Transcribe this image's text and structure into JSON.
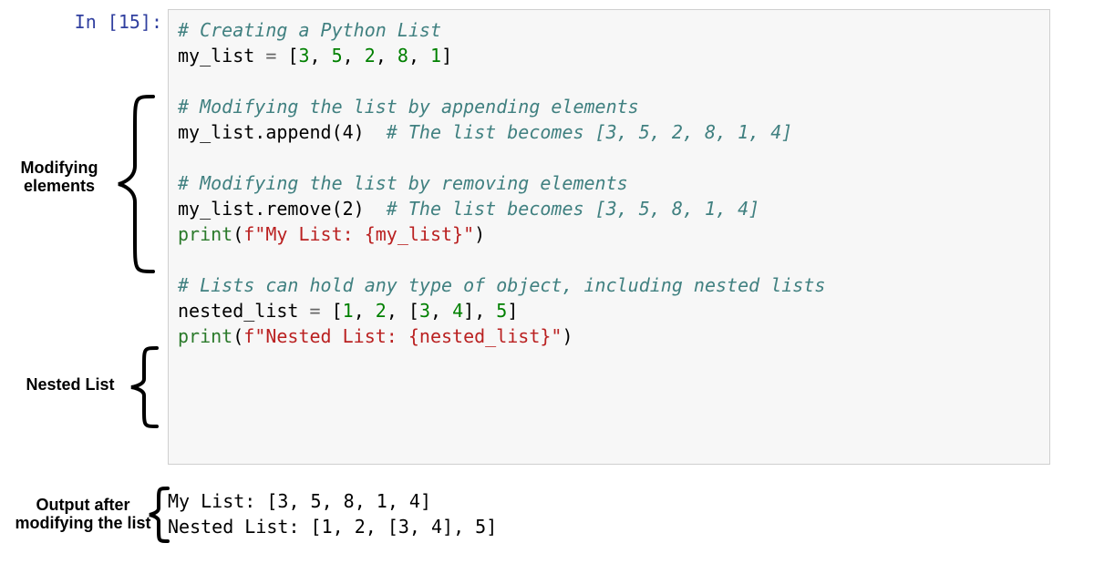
{
  "prompt": {
    "label": "In [15]:"
  },
  "code": {
    "c1": "# Creating a Python List",
    "assign1_lhs": "my_list",
    "eq": "=",
    "assign1_rhs": "[3, 5, 2, 8, 1]",
    "c2": "# Modifying the list by appending elements",
    "append_call": "my_list.append(4)",
    "append_comment": "# The list becomes [3, 5, 2, 8, 1, 4]",
    "c3": "# Modifying the list by removing elements",
    "remove_call": "my_list.remove(2)",
    "remove_comment": "# The list becomes [3, 5, 8, 1, 4]",
    "print1_pre": "print(f",
    "print1_str": "\"My List: {my_list}\"",
    "print1_post": ")",
    "c4": "# Lists can hold any type of object, including nested lists",
    "assign2_lhs": "nested_list",
    "assign2_rhs_open": "[",
    "assign2_v1": "1",
    "assign2_v2": "2",
    "assign2_v3_open": "[",
    "assign2_v3a": "3",
    "assign2_v3b": "4",
    "assign2_v3_close": "]",
    "assign2_v4": "5",
    "assign2_rhs_close": "]",
    "comma": ", ",
    "print2_pre": "print(f",
    "print2_str": "\"Nested List: {nested_list}\"",
    "print2_post": ")"
  },
  "output": {
    "l1": "My List: [3, 5, 8, 1, 4]",
    "l2": "Nested List: [1, 2, [3, 4], 5]"
  },
  "annot": {
    "modifying": "Modifying\nelements",
    "nested": "Nested List",
    "output": "Output after\nmodifying the list"
  }
}
